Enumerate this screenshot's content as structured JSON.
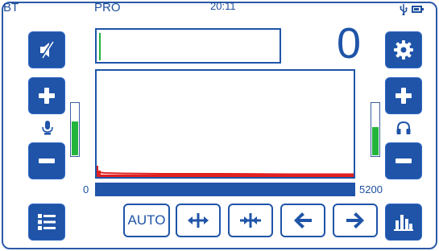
{
  "status_bar": {
    "bt_label": "BT",
    "mode_label": "PRO",
    "time": "20:11",
    "usb_icon": "usb-icon",
    "battery_icon": "battery-icon"
  },
  "counter": {
    "value": "0"
  },
  "spectrum": {
    "scale_min": "0",
    "scale_max": "5200"
  },
  "levels": {
    "mic_level": 0.65,
    "headphone_level": 0.55
  },
  "controls": {
    "auto_label": "AUTO",
    "left": [
      {
        "icon": "speaker-mute-icon"
      },
      {
        "icon": "plus-icon"
      },
      {
        "icon": "microphone-icon"
      },
      {
        "icon": "minus-icon"
      },
      {
        "icon": "menu-list-icon"
      }
    ],
    "right": [
      {
        "icon": "gear-icon"
      },
      {
        "icon": "plus-icon"
      },
      {
        "icon": "headphones-icon"
      },
      {
        "icon": "minus-icon"
      },
      {
        "icon": "bar-chart-icon"
      }
    ],
    "bottom": [
      {
        "icon": "expand-horizontal-icon"
      },
      {
        "icon": "compress-horizontal-icon"
      },
      {
        "icon": "arrow-left-icon"
      },
      {
        "icon": "arrow-right-icon"
      }
    ]
  },
  "colors": {
    "primary": "#1f54a8",
    "level_green": "#23b53b",
    "spectrum_red": "#e02020"
  }
}
